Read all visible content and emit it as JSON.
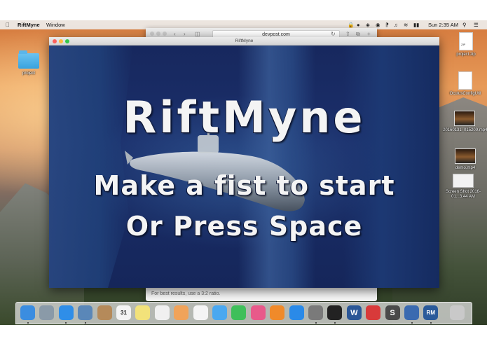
{
  "menubar": {
    "app_name": "RiftMyne",
    "menu_window": "Window",
    "clock": "Sun 2:35 AM"
  },
  "desktop_icons": [
    {
      "label": "project"
    },
    {
      "label": "project.zip",
      "badge": "ZIP"
    },
    {
      "label": "OculusConfigUtil"
    },
    {
      "label": "20160131_015209.mp4"
    },
    {
      "label": "demo.mp4"
    },
    {
      "label": "Screen Shot 2016-01...3.44 AM"
    }
  ],
  "browser": {
    "url": "devpost.com",
    "footer_text": "For best results, use a 3:2 ratio."
  },
  "game_window": {
    "title": "RiftMyne",
    "headline": "RiftMyne",
    "line1": "Make a fist to start",
    "line2": "Or Press Space"
  },
  "dock": {
    "items": [
      {
        "icon": "finder-icon",
        "color": "#3b8de0"
      },
      {
        "icon": "launchpad-icon",
        "color": "#8a9aa8"
      },
      {
        "icon": "safari-icon",
        "color": "#2f8ee8"
      },
      {
        "icon": "preview-icon",
        "color": "#5a87b8"
      },
      {
        "icon": "contacts-icon",
        "color": "#b58a5a"
      },
      {
        "icon": "calendar-icon",
        "color": "#f4f4f4",
        "text": "31"
      },
      {
        "icon": "notes-icon",
        "color": "#f2e27a"
      },
      {
        "icon": "reminders-icon",
        "color": "#f0f0f0"
      },
      {
        "icon": "photos-icon",
        "color": "#f0a35a"
      },
      {
        "icon": "textedit-icon",
        "color": "#f4f4f4"
      },
      {
        "icon": "messages-icon",
        "color": "#4aa8f0"
      },
      {
        "icon": "facetime-icon",
        "color": "#3fbf5a"
      },
      {
        "icon": "itunes-icon",
        "color": "#e85a8a"
      },
      {
        "icon": "ibooks-icon",
        "color": "#f08a2a"
      },
      {
        "icon": "app-store-icon",
        "color": "#2a8ae8"
      },
      {
        "icon": "system-preferences-icon",
        "color": "#7a7a7a"
      },
      {
        "icon": "terminal-icon",
        "color": "#222222"
      },
      {
        "icon": "word-icon",
        "color": "#2b5797",
        "text": "W"
      },
      {
        "icon": "parallels-icon",
        "color": "#d83a3a"
      },
      {
        "icon": "sublime-icon",
        "color": "#4a4a4a",
        "text": "S"
      },
      {
        "icon": "quicktime-icon",
        "color": "#3a6ab0"
      },
      {
        "icon": "riftmyne-icon",
        "color": "#2a5a9a",
        "text": "RM"
      },
      {
        "icon": "trash-icon",
        "color": "#c9c9c9"
      }
    ]
  }
}
